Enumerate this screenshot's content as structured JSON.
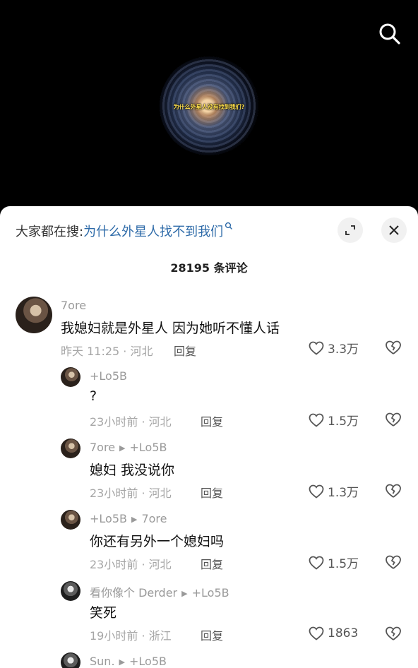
{
  "video": {
    "caption": "为什么外星人没有找到我们?",
    "search_icon": "search-icon"
  },
  "sheet": {
    "hot_search_prefix": "大家都在搜:",
    "hot_search_query": "为什么外星人找不到我们",
    "expand_icon": "expand-icon",
    "close_icon": "close-icon",
    "comment_count": "28195 条评论"
  },
  "comments": [
    {
      "user": "7ore",
      "text": "我媳妇就是外星人 因为她听不懂人话",
      "time": "昨天 11:25 · 河北",
      "reply": "回复",
      "likes": "3.3万"
    },
    {
      "user": "+Lo5B",
      "text": "?",
      "time": "23小时前 · 河北",
      "reply": "回复",
      "likes": "1.5万"
    },
    {
      "user": "7ore",
      "reply_to": "+Lo5B",
      "text": "媳妇 我没说你",
      "time": "23小时前 · 河北",
      "reply": "回复",
      "likes": "1.3万"
    },
    {
      "user": "+Lo5B",
      "reply_to": "7ore",
      "text": "你还有另外一个媳妇吗",
      "time": "23小时前 · 河北",
      "reply": "回复",
      "likes": "1.5万"
    },
    {
      "user": "看你像个 Derder",
      "reply_to": "+Lo5B",
      "text": "笑死",
      "time": "19小时前 · 浙江",
      "reply": "回复",
      "likes": "1863"
    },
    {
      "user": "Sun.",
      "reply_to": "+Lo5B"
    }
  ]
}
